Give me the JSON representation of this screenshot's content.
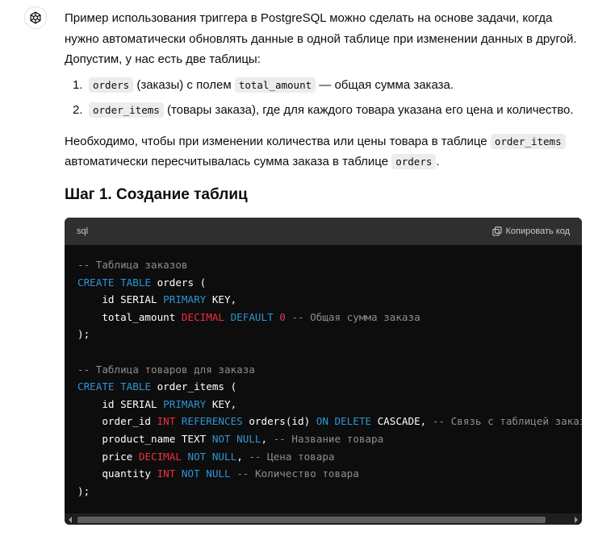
{
  "message": {
    "intro": "Пример использования триггера в PostgreSQL можно сделать на основе задачи, когда нужно автоматически обновлять данные в одной таблице при изменении данных в другой. Допустим, у нас есть две таблицы:",
    "list": [
      {
        "num": "1.",
        "code": "orders",
        "text1": " (заказы) с полем ",
        "code2": "total_amount",
        "text2": " — общая сумма заказа."
      },
      {
        "num": "2.",
        "code": "order_items",
        "text1": " (товары заказа), где для каждого товара указана его цена и количество."
      }
    ],
    "p2_part1": "Необходимо, чтобы при изменении количества или цены товара в таблице ",
    "p2_code1": "order_items",
    "p2_part2": " автоматически пересчитывалась сумма заказа в таблице ",
    "p2_code2": "orders",
    "p2_part3": ".",
    "heading": "Шаг 1. Создание таблиц"
  },
  "code_block": {
    "language": "sql",
    "copy_label": "Копировать код",
    "lines": [
      "-- Таблица заказов",
      "CREATE TABLE orders (",
      "    id SERIAL PRIMARY KEY,",
      "    total_amount DECIMAL DEFAULT 0 -- Общая сумма заказа",
      ");",
      "",
      "-- Таблица товаров для заказа",
      "CREATE TABLE order_items (",
      "    id SERIAL PRIMARY KEY,",
      "    order_id INT REFERENCES orders(id) ON DELETE CASCADE, -- Связь с таблицей заказ",
      "    product_name TEXT NOT NULL, -- Название товара",
      "    price DECIMAL NOT NULL, -- Цена товара",
      "    quantity INT NOT NULL -- Количество товара",
      ");"
    ]
  },
  "colors": {
    "comment": "#8e8e8e",
    "keyword": "#2e95d3",
    "type": "#f22c3d",
    "number": "#df3079",
    "code_bg": "#0d0d0d",
    "header_bg": "#2f2f2f"
  },
  "icons": {
    "avatar": "openai-logo-icon",
    "copy": "copy-icon"
  }
}
